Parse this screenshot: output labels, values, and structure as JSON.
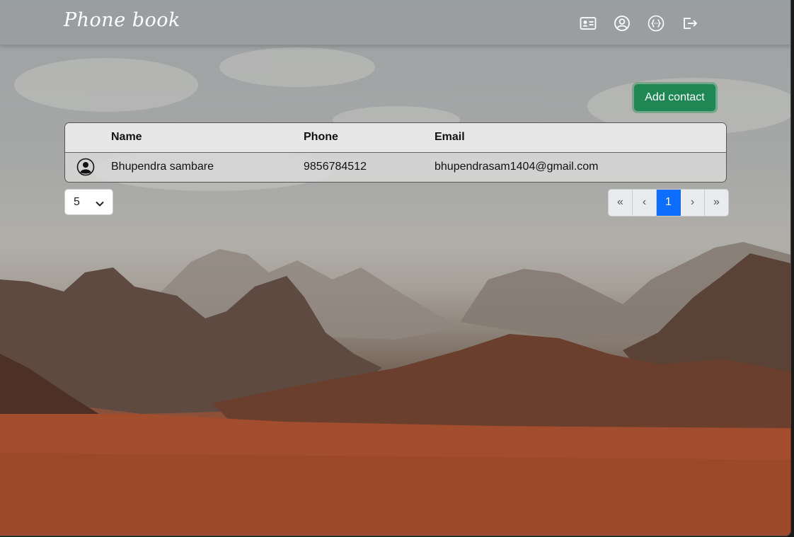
{
  "navbar": {
    "brand": "Phone book",
    "icons": [
      "contact-card-icon",
      "user-circle-icon",
      "code-braces-icon",
      "logout-icon"
    ]
  },
  "actions": {
    "add_contact_label": "Add contact"
  },
  "table": {
    "columns": [
      "",
      "Name",
      "Phone",
      "Email"
    ],
    "rows": [
      {
        "name": "Bhupendra sambare",
        "phone": "9856784512",
        "email": "bhupendrasam1404@gmail.com"
      }
    ]
  },
  "pagination": {
    "page_size": "5",
    "first": "«",
    "prev": "‹",
    "current": "1",
    "next": "›",
    "last": "»"
  },
  "colors": {
    "primary": "#0d6efd",
    "success": "#1e8754",
    "sand": "#a54f2f",
    "sky": "#a6a8a7"
  }
}
